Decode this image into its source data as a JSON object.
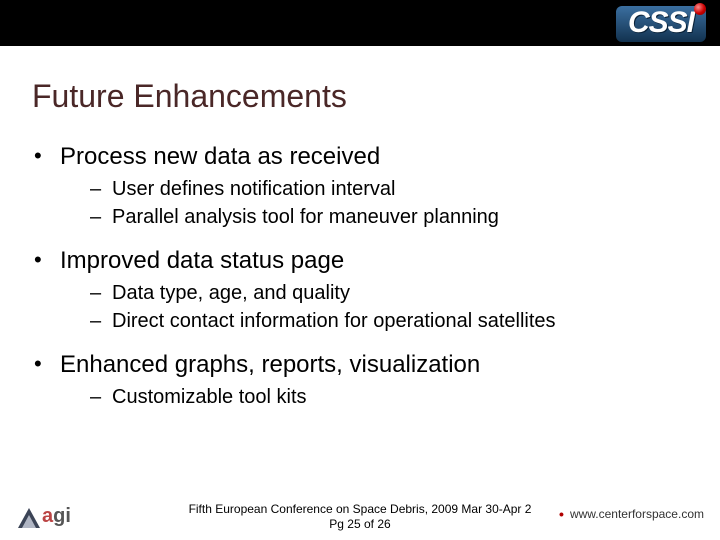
{
  "header": {
    "logo_letters": [
      "C",
      "S",
      "S",
      "I"
    ]
  },
  "title": "Future Enhancements",
  "bullets": [
    {
      "text": "Process new data as received",
      "sub": [
        "User defines notification interval",
        "Parallel analysis tool for maneuver planning"
      ]
    },
    {
      "text": "Improved data status page",
      "sub": [
        "Data type, age, and quality",
        "Direct contact information for operational satellites"
      ]
    },
    {
      "text": "Enhanced graphs, reports, visualization",
      "sub": [
        "Customizable tool kits"
      ]
    }
  ],
  "footer": {
    "conference_line1": "Fifth European Conference on Space Debris, 2009 Mar 30-Apr 2",
    "conference_line2": "Pg 25 of 26",
    "agi_label_a": "a",
    "agi_label_g": "g",
    "agi_label_i": "i",
    "site_label": "www.centerforspace.com",
    "site_bullet": "•"
  }
}
